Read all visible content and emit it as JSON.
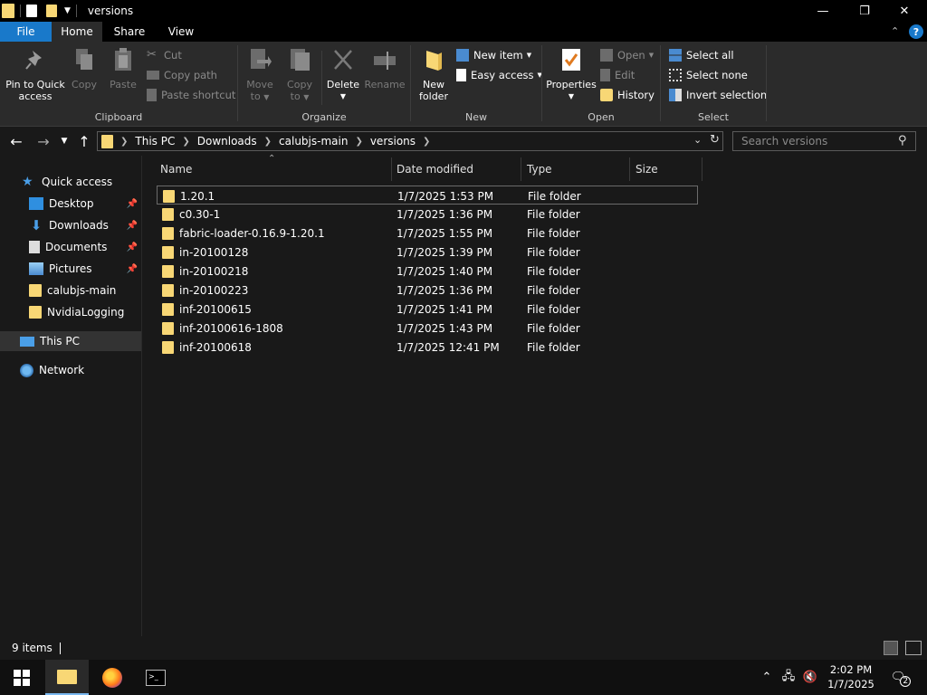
{
  "window": {
    "title": "versions",
    "minimize_glyph": "—",
    "maximize_glyph": "❐",
    "close_glyph": "✕"
  },
  "ribbon_tabs": [
    "File",
    "Home",
    "Share",
    "View"
  ],
  "ribbon": {
    "clipboard": {
      "label": "Clipboard",
      "pin_line1": "Pin to Quick",
      "pin_line2": "access",
      "copy": "Copy",
      "paste": "Paste",
      "cut": "Cut",
      "copy_path": "Copy path",
      "paste_shortcut": "Paste shortcut"
    },
    "organize": {
      "label": "Organize",
      "move_line1": "Move",
      "move_line2": "to",
      "copy_line1": "Copy",
      "copy_line2": "to",
      "delete": "Delete",
      "rename": "Rename"
    },
    "new": {
      "label": "New",
      "new_folder_line1": "New",
      "new_folder_line2": "folder",
      "new_item": "New item",
      "easy_access": "Easy access"
    },
    "open": {
      "label": "Open",
      "properties": "Properties",
      "open": "Open",
      "edit": "Edit",
      "history": "History"
    },
    "select": {
      "label": "Select",
      "select_all": "Select all",
      "select_none": "Select none",
      "invert_selection": "Invert selection"
    }
  },
  "address": {
    "crumbs": [
      "This PC",
      "Downloads",
      "calubjs-main",
      "versions"
    ],
    "search_placeholder": "Search versions"
  },
  "nav_pane": {
    "quick_access": "Quick access",
    "items": [
      "Desktop",
      "Downloads",
      "Documents",
      "Pictures",
      "calubjs-main",
      "NvidiaLogging"
    ],
    "this_pc": "This PC",
    "network": "Network"
  },
  "columns": [
    "Name",
    "Date modified",
    "Type",
    "Size"
  ],
  "files": [
    {
      "name": "1.20.1",
      "date": "1/7/2025 1:53 PM",
      "type": "File folder",
      "size": ""
    },
    {
      "name": "c0.30-1",
      "date": "1/7/2025 1:36 PM",
      "type": "File folder",
      "size": ""
    },
    {
      "name": "fabric-loader-0.16.9-1.20.1",
      "date": "1/7/2025 1:55 PM",
      "type": "File folder",
      "size": ""
    },
    {
      "name": "in-20100128",
      "date": "1/7/2025 1:39 PM",
      "type": "File folder",
      "size": ""
    },
    {
      "name": "in-20100218",
      "date": "1/7/2025 1:40 PM",
      "type": "File folder",
      "size": ""
    },
    {
      "name": "in-20100223",
      "date": "1/7/2025 1:36 PM",
      "type": "File folder",
      "size": ""
    },
    {
      "name": "inf-20100615",
      "date": "1/7/2025 1:41 PM",
      "type": "File folder",
      "size": ""
    },
    {
      "name": "inf-20100616-1808",
      "date": "1/7/2025 1:43 PM",
      "type": "File folder",
      "size": ""
    },
    {
      "name": "inf-20100618",
      "date": "1/7/2025 12:41 PM",
      "type": "File folder",
      "size": ""
    }
  ],
  "status": {
    "item_count": "9 items"
  },
  "taskbar": {
    "time": "2:02 PM",
    "date": "1/7/2025",
    "notification_count": "2"
  }
}
